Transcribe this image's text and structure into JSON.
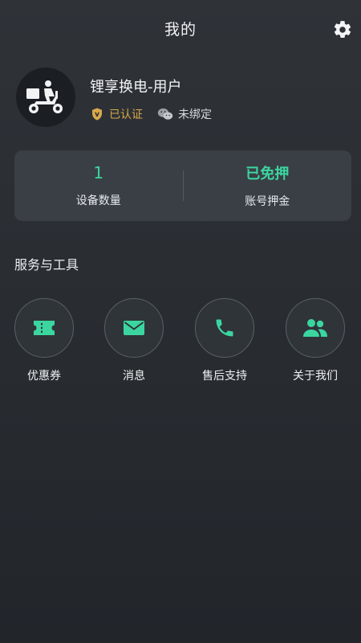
{
  "header": {
    "title": "我的"
  },
  "profile": {
    "name": "锂享换电-用户",
    "verified_label": "已认证",
    "wechat_label": "未绑定"
  },
  "stats": [
    {
      "value": "1",
      "label": "设备数量"
    },
    {
      "value": "已免押",
      "label": "账号押金"
    }
  ],
  "services": {
    "title": "服务与工具",
    "items": [
      {
        "label": "优惠券",
        "icon": "coupon-icon"
      },
      {
        "label": "消息",
        "icon": "mail-icon"
      },
      {
        "label": "售后支持",
        "icon": "phone-icon"
      },
      {
        "label": "关于我们",
        "icon": "people-icon"
      }
    ]
  },
  "colors": {
    "accent": "#3bd6a0",
    "gold": "#d9a84a",
    "card": "#3a3f45",
    "background": "#2c3035"
  }
}
